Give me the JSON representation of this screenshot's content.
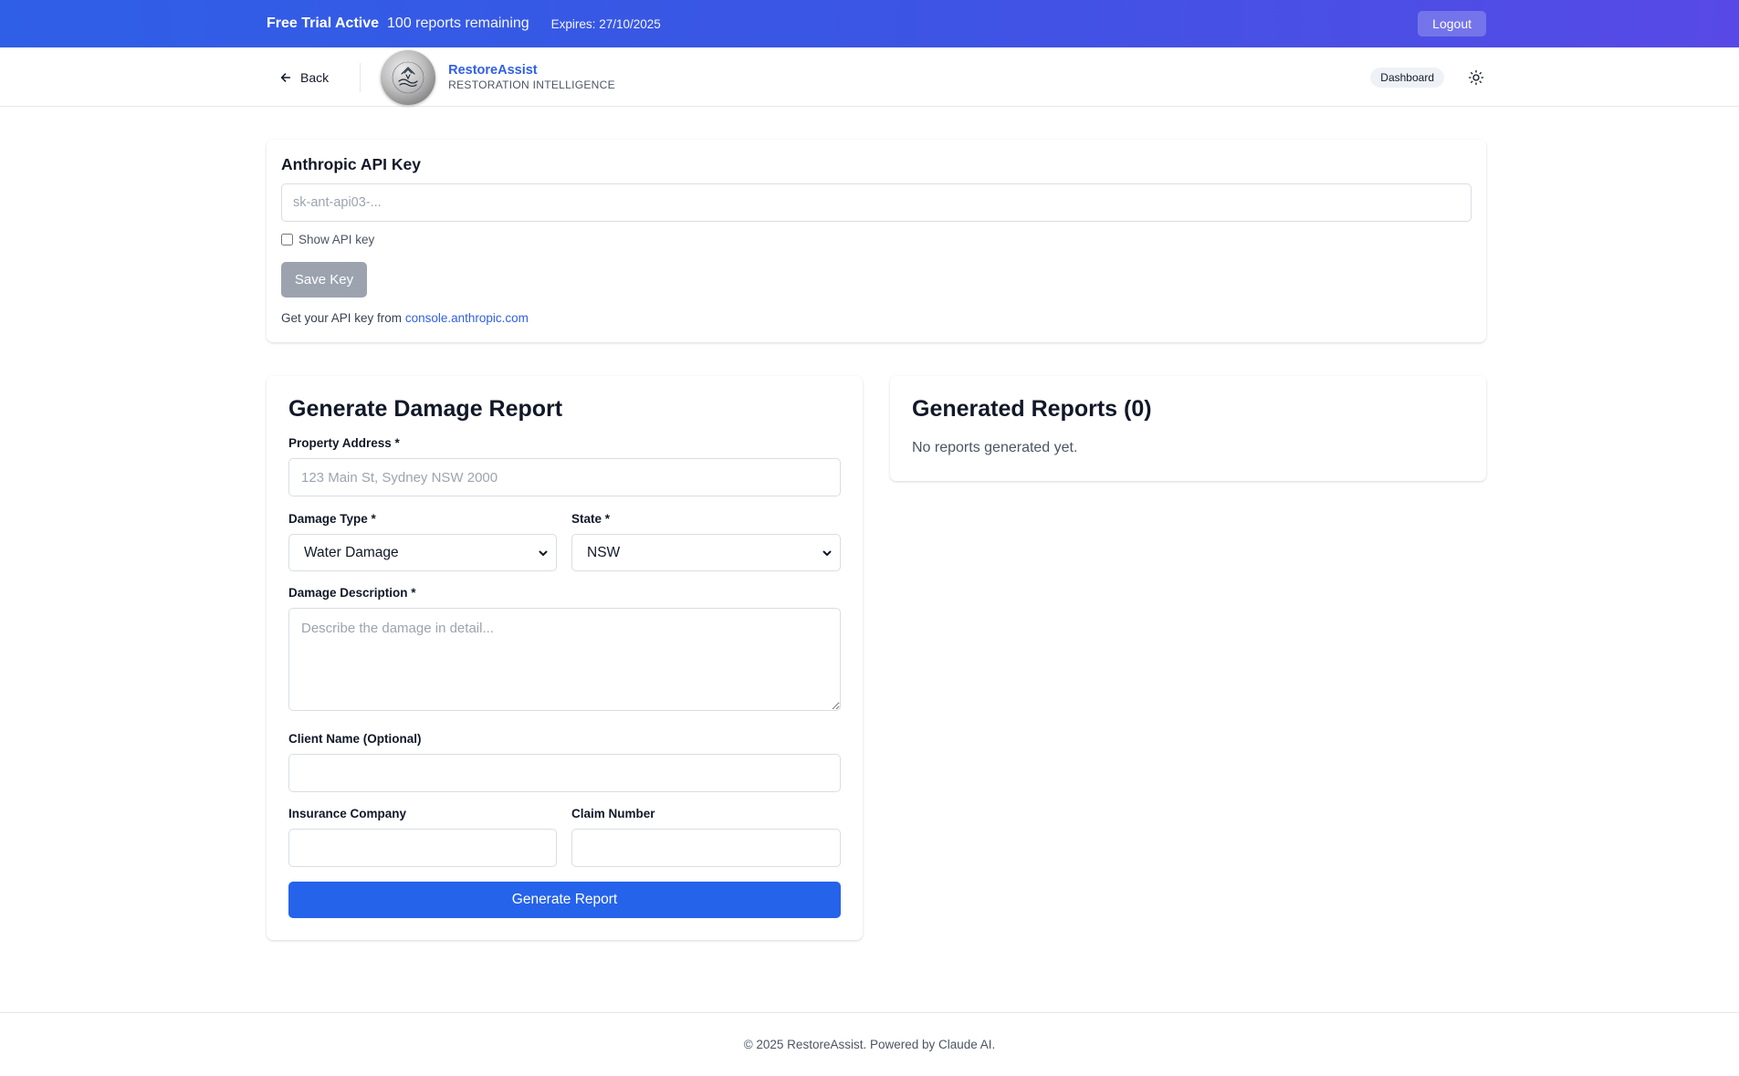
{
  "trial_bar": {
    "title": "Free Trial Active",
    "remaining": "100 reports remaining",
    "expires": "Expires: 27/10/2025",
    "logout_label": "Logout"
  },
  "header": {
    "back_label": "Back",
    "brand_name": "RestoreAssist",
    "brand_tagline": "RESTORATION INTELLIGENCE",
    "dashboard_label": "Dashboard",
    "back_icon": "arrow-left-icon",
    "theme_icon": "sun-icon"
  },
  "api_key": {
    "title": "Anthropic API Key",
    "placeholder": "sk-ant-api03-...",
    "value": "",
    "show_label": "Show API key",
    "show_checked": false,
    "save_label": "Save Key",
    "help_prefix": "Get your API key from",
    "help_link": "console.anthropic.com"
  },
  "form": {
    "title": "Generate Damage Report",
    "address_label": "Property Address *",
    "address_placeholder": "123 Main St, Sydney NSW 2000",
    "damage_type_label": "Damage Type *",
    "damage_type_value": "Water Damage",
    "state_label": "State *",
    "state_value": "NSW",
    "description_label": "Damage Description *",
    "description_placeholder": "Describe the damage in detail...",
    "client_label": "Client Name (Optional)",
    "insurance_label": "Insurance Company",
    "claim_label": "Claim Number",
    "generate_label": "Generate Report"
  },
  "reports": {
    "title": "Generated Reports (0)",
    "empty_text": "No reports generated yet."
  },
  "footer": {
    "text": "© 2025 RestoreAssist. Powered by Claude AI."
  },
  "colors": {
    "accent": "#2563eb",
    "brand": "#2f5fe6",
    "gradient_start": "#2f5fe6",
    "gradient_end": "#5849e6",
    "disabled_button": "#9ca3af"
  }
}
